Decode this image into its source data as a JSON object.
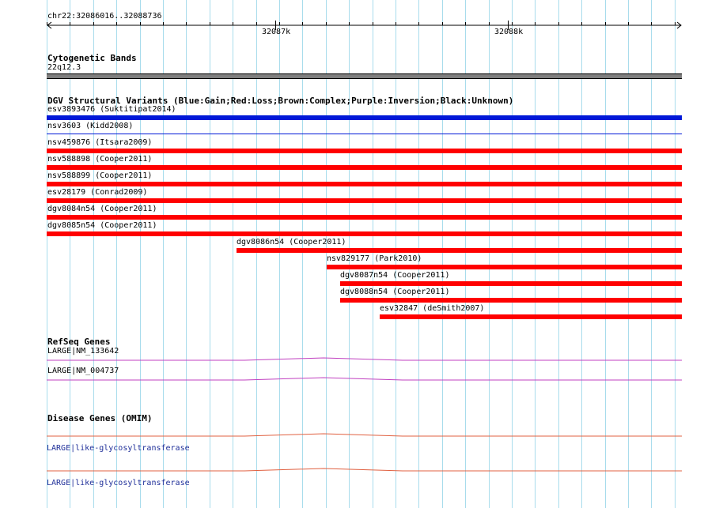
{
  "ruler": {
    "location": "chr22:32086016..32088736",
    "ticks": [
      "32087k",
      "32088k"
    ]
  },
  "cytoband": {
    "title": "Cytogenetic Bands",
    "band": "22q12.3"
  },
  "dgv": {
    "title": "DGV Structural Variants (Blue:Gain;Red:Loss;Brown:Complex;Purple:Inversion;Black:Unknown)",
    "items": [
      {
        "label": "esv3893476 (Suktitipat2014)",
        "type": "gain",
        "style": "thick"
      },
      {
        "label": "nsv3603 (Kidd2008)",
        "type": "gain",
        "style": "thin"
      },
      {
        "label": "nsv459876 (Itsara2009)",
        "type": "loss",
        "style": "thick"
      },
      {
        "label": "nsv588898 (Cooper2011)",
        "type": "loss",
        "style": "thick"
      },
      {
        "label": "nsv588899 (Cooper2011)",
        "type": "loss",
        "style": "thick"
      },
      {
        "label": "esv28179 (Conrad2009)",
        "type": "loss",
        "style": "thick"
      },
      {
        "label": "dgv8084n54 (Cooper2011)",
        "type": "loss",
        "style": "thick"
      },
      {
        "label": "dgv8085n54 (Cooper2011)",
        "type": "loss",
        "style": "thick"
      },
      {
        "label": "dgv8086n54 (Cooper2011)",
        "type": "loss",
        "style": "thick"
      },
      {
        "label": "nsv829177 (Park2010)",
        "type": "loss",
        "style": "thick"
      },
      {
        "label": "dgv8087n54 (Cooper2011)",
        "type": "loss",
        "style": "thick"
      },
      {
        "label": "dgv8088n54 (Cooper2011)",
        "type": "loss",
        "style": "thick"
      },
      {
        "label": "esv32847 (deSmith2007)",
        "type": "loss",
        "style": "thick"
      }
    ]
  },
  "refseq": {
    "title": "RefSeq Genes",
    "genes": [
      {
        "label": "LARGE|NM_133642"
      },
      {
        "label": "LARGE|NM_004737"
      }
    ]
  },
  "omim": {
    "title": "Disease Genes (OMIM)",
    "genes": [
      {
        "label": "LARGE|like-glycosyltransferase"
      },
      {
        "label": "LARGE|like-glycosyltransferase"
      }
    ]
  },
  "colors": {
    "grid": "#a8dcec",
    "gain": "#0018d8",
    "loss": "#ff0000",
    "refseq": "#c040c0",
    "omim": "#e06040",
    "band": "#7f7f7f"
  }
}
